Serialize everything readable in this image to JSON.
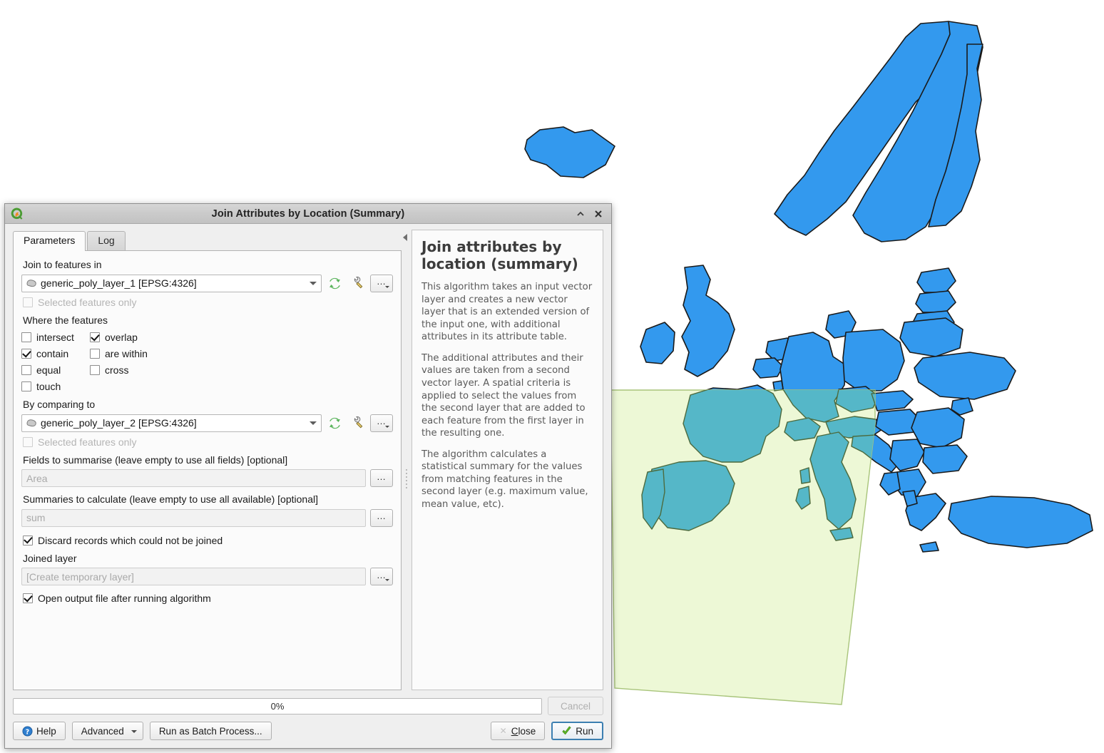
{
  "window": {
    "title": "Join Attributes by Location (Summary)",
    "logo_icon": "qgis-logo-icon",
    "shade_icon": "chevron-up-icon",
    "close_icon": "close-x-icon"
  },
  "tabs": [
    {
      "label": "Parameters",
      "active": true
    },
    {
      "label": "Log",
      "active": false
    }
  ],
  "parameters": {
    "join_to_features_in": {
      "label": "Join to features in",
      "value": "generic_poly_layer_1 [EPSG:4326]",
      "layer_icon": "polygon-layer-icon",
      "iterate_icon": "iterate-refresh-icon",
      "tool_icon": "wrench-icon",
      "browse_label": "…"
    },
    "selected_only_1": {
      "label": "Selected features only",
      "checked": false,
      "enabled": false
    },
    "where_the_features": {
      "label": "Where the features"
    },
    "predicates": [
      {
        "label": "intersect",
        "checked": false
      },
      {
        "label": "overlap",
        "checked": true
      },
      {
        "label": "contain",
        "checked": true
      },
      {
        "label": "are within",
        "checked": false
      },
      {
        "label": "equal",
        "checked": false
      },
      {
        "label": "cross",
        "checked": false
      },
      {
        "label": "touch",
        "checked": false
      }
    ],
    "by_comparing_to": {
      "label": "By comparing to",
      "value": "generic_poly_layer_2 [EPSG:4326]",
      "layer_icon": "polygon-layer-icon",
      "iterate_icon": "iterate-refresh-icon",
      "tool_icon": "wrench-icon",
      "browse_label": "…"
    },
    "selected_only_2": {
      "label": "Selected features only",
      "checked": false,
      "enabled": false
    },
    "fields_to_summarise": {
      "label": "Fields to summarise (leave empty to use all fields) [optional]",
      "placeholder": "Area",
      "browse_label": "…"
    },
    "summaries_to_calculate": {
      "label": "Summaries to calculate (leave empty to use all available) [optional]",
      "placeholder": "sum",
      "browse_label": "…"
    },
    "discard_records": {
      "label": "Discard records which could not be joined",
      "checked": true
    },
    "joined_layer": {
      "label": "Joined layer",
      "placeholder": "[Create temporary layer]",
      "browse_label": "…"
    },
    "open_output": {
      "label": "Open output file after running algorithm",
      "checked": true
    }
  },
  "help": {
    "collapse_icon": "collapse-left-arrow-icon",
    "title": "Join attributes by location (summary)",
    "paragraphs": [
      "This algorithm takes an input vector layer and creates a new vector layer that is an extended version of the input one, with additional attributes in its attribute table.",
      "The additional attributes and their values are taken from a second vector layer. A spatial criteria is applied to select the values from the second layer that are added to each feature from the first layer in the resulting one.",
      "The algorithm calculates a statistical summary for the values from matching features in the second layer (e.g. maximum value, mean value, etc)."
    ]
  },
  "footer": {
    "progress_text": "0%",
    "cancel_label": "Cancel",
    "help_label": "Help",
    "help_icon": "question-circle-icon",
    "advanced_label": "Advanced",
    "advanced_menu_icon": "chevron-down-icon",
    "batch_label": "Run as Batch Process...",
    "close_label": "Close",
    "close_icon": "close-x-icon",
    "run_label": "Run",
    "run_icon": "green-check-icon"
  },
  "map": {
    "country_fill": "#3399ee",
    "country_stroke": "#1a1a1a",
    "overlay_fill": "#eaf7cf",
    "overlay_stroke": "#8aa85f",
    "intersect_tint": "#55b7c8"
  }
}
